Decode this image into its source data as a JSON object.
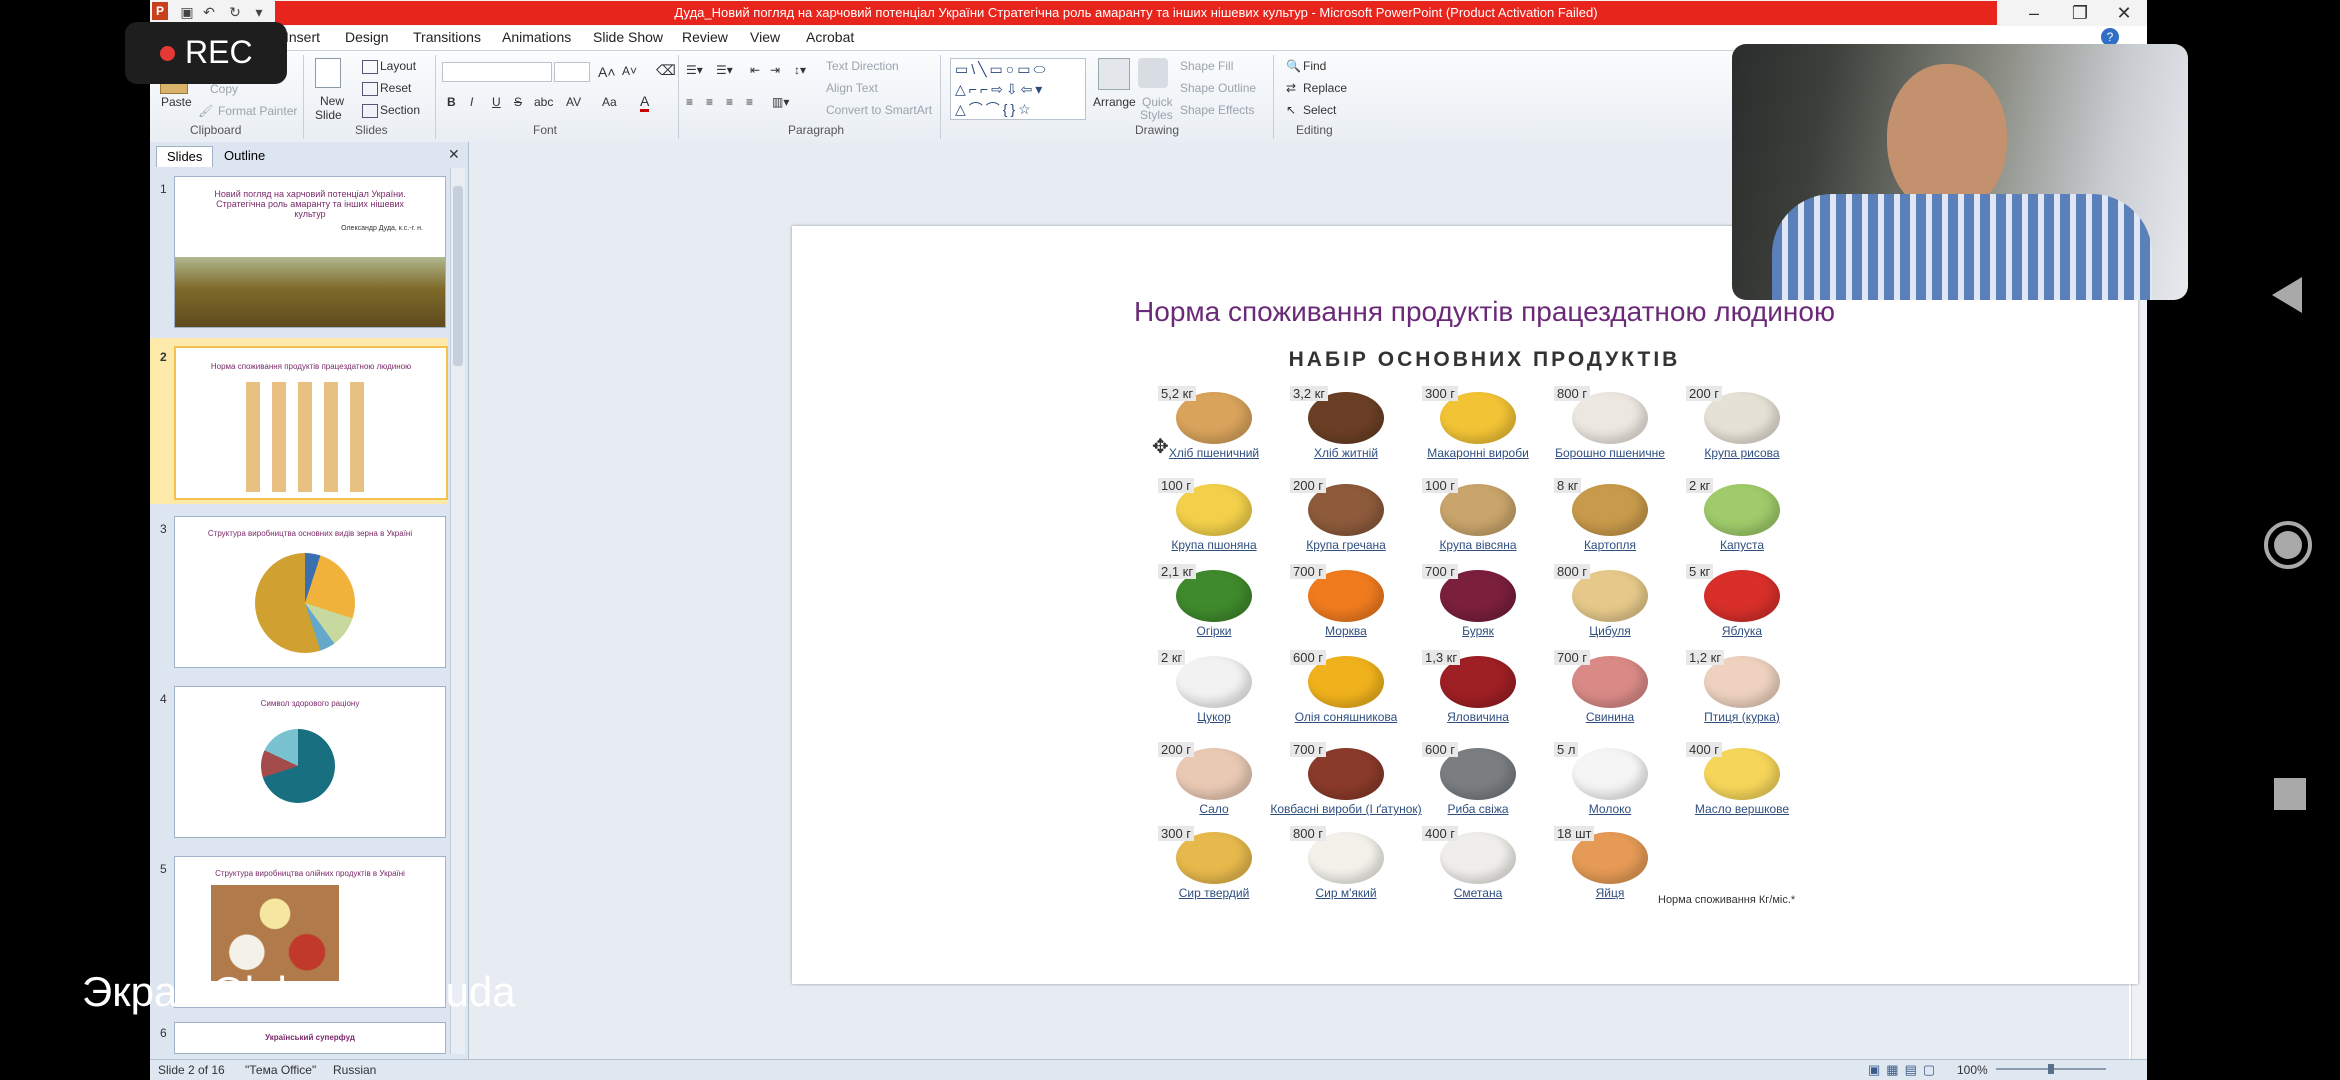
{
  "window": {
    "title": "Дуда_Новий погляд на харчовий потенціал України Стратегічна роль амаранту та інших нішевих культур  -  Microsoft PowerPoint (Product Activation Failed)"
  },
  "ribbon": {
    "tabs": [
      "Insert",
      "Design",
      "Transitions",
      "Animations",
      "Slide Show",
      "Review",
      "View",
      "Acrobat"
    ],
    "clipboard": {
      "paste": "Paste",
      "copy": "Copy",
      "format_painter": "Format Painter",
      "group": "Clipboard"
    },
    "slides": {
      "new_slide_1": "New",
      "new_slide_2": "Slide",
      "layout": "Layout",
      "reset": "Reset",
      "section": "Section",
      "group": "Slides"
    },
    "font": {
      "group": "Font",
      "bold": "B",
      "italic": "I",
      "underline": "U",
      "strike": "S",
      "shadow": "abc",
      "spacing": "AV",
      "case": "Aa",
      "color": "A"
    },
    "paragraph": {
      "text_direction": "Text Direction",
      "align_text": "Align Text",
      "smartart": "Convert to SmartArt",
      "group": "Paragraph"
    },
    "drawing": {
      "arrange": "Arrange",
      "quick_styles_1": "Quick",
      "quick_styles_2": "Styles",
      "shape_fill": "Shape Fill",
      "shape_outline": "Shape Outline",
      "shape_effects": "Shape Effects",
      "group": "Drawing"
    },
    "editing": {
      "find": "Find",
      "replace": "Replace",
      "select": "Select",
      "group": "Editing"
    }
  },
  "pane": {
    "tabs": [
      "Slides",
      "Outline"
    ],
    "thumbs": [
      {
        "num": "1",
        "title": "Новий погляд на харчовий потенціал України. Стратегічна роль амаранту та інших нішевих культур",
        "author": "Олександр Дуда, к.с.-г. н."
      },
      {
        "num": "2",
        "title": "Норма споживання продуктів працездатною людиною",
        "author": ""
      },
      {
        "num": "3",
        "title": "Структура виробництва основних видів зерна в Україні",
        "author": ""
      },
      {
        "num": "4",
        "title": "Символ здорового раціону",
        "author": ""
      },
      {
        "num": "5",
        "title": "Структура виробництва олійних продуктів в Україні",
        "author": ""
      },
      {
        "num": "6",
        "title": "Український суперфуд",
        "author": ""
      }
    ]
  },
  "slide": {
    "title": "Норма споживання продуктів працездатною людиною",
    "subtitle": "НАБІР ОСНОВНИХ ПРОДУКТІВ",
    "note": "Норма споживання Кг/міс.*",
    "items": [
      {
        "qty": "5,2 кг",
        "name": "Хліб пшеничний",
        "color": "#d9a35b"
      },
      {
        "qty": "3,2 кг",
        "name": "Хліб житній",
        "color": "#6b3f25"
      },
      {
        "qty": "300 г",
        "name": "Макаронні вироби",
        "color": "#f2c335"
      },
      {
        "qty": "800 г",
        "name": "Борошно пшеничне",
        "color": "#ece7df"
      },
      {
        "qty": "200 г",
        "name": "Крупа рисова",
        "color": "#e6e1d6"
      },
      {
        "qty": "100 г",
        "name": "Крупа пшоняна",
        "color": "#f3d04a"
      },
      {
        "qty": "200 г",
        "name": "Крупа гречана",
        "color": "#8d5a3b"
      },
      {
        "qty": "100 г",
        "name": "Крупа вівсяна",
        "color": "#c9a46b"
      },
      {
        "qty": "8 кг",
        "name": "Картопля",
        "color": "#c89a4b"
      },
      {
        "qty": "2 кг",
        "name": "Капуста",
        "color": "#9fcb6a"
      },
      {
        "qty": "2,1 кг",
        "name": "Огірки",
        "color": "#3f8a2c"
      },
      {
        "qty": "700 г",
        "name": "Морква",
        "color": "#f07b1f"
      },
      {
        "qty": "700 г",
        "name": "Буряк",
        "color": "#7a1f3c"
      },
      {
        "qty": "800 г",
        "name": "Цибуля",
        "color": "#e6c98a"
      },
      {
        "qty": "5 кг",
        "name": "Яблука",
        "color": "#d82f2a"
      },
      {
        "qty": "2 кг",
        "name": "Цукор",
        "color": "#f2f2f2"
      },
      {
        "qty": "600 г",
        "name": "Олія соняшникова",
        "color": "#f0b21c"
      },
      {
        "qty": "1,3 кг",
        "name": "Яловичина",
        "color": "#9e1f24"
      },
      {
        "qty": "700 г",
        "name": "Свинина",
        "color": "#d98a86"
      },
      {
        "qty": "1,2 кг",
        "name": "Птиця (курка)",
        "color": "#eed2bf"
      },
      {
        "qty": "200 г",
        "name": "Сало",
        "color": "#e9c9b4"
      },
      {
        "qty": "700 г",
        "name": "Ковбасні вироби (І ґатунок)",
        "color": "#8a3a2a"
      },
      {
        "qty": "600 г",
        "name": "Риба свіжа",
        "color": "#7a7e80"
      },
      {
        "qty": "5 л",
        "name": "Молоко",
        "color": "#f5f5f5"
      },
      {
        "qty": "400 г",
        "name": "Масло вершкове",
        "color": "#f6d65a"
      },
      {
        "qty": "300 г",
        "name": "Сир твердий",
        "color": "#e7b94c"
      },
      {
        "qty": "800 г",
        "name": "Сир м'який",
        "color": "#f3f1ea"
      },
      {
        "qty": "400 г",
        "name": "Сметана",
        "color": "#f0eeea"
      },
      {
        "qty": "18 шт",
        "name": "Яйця",
        "color": "#e59a55"
      }
    ]
  },
  "status": {
    "slide": "Slide 2 of 16",
    "theme": "\"Тема Office\"",
    "lang": "Russian",
    "zoom": "100%"
  },
  "overlay": {
    "rec": "REC",
    "caption": "Экран Oleksandr Duda"
  }
}
